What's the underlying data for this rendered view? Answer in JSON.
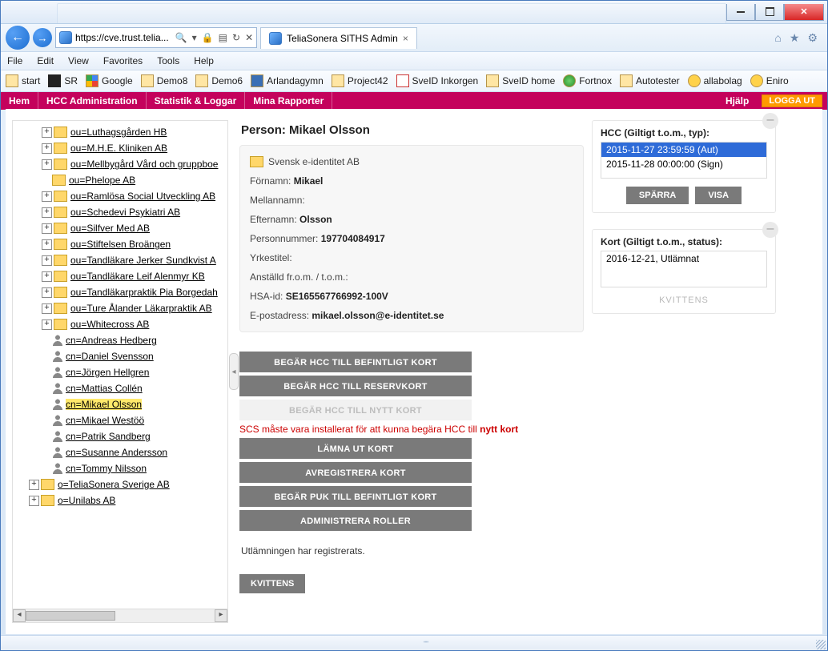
{
  "window": {
    "address_text": "https://cve.trust.telia...",
    "tab_title": "TeliaSonera SITHS Admin"
  },
  "menu": {
    "file": "File",
    "edit": "Edit",
    "view": "View",
    "favorites": "Favorites",
    "tools": "Tools",
    "help": "Help"
  },
  "favbar": [
    "start",
    "SR",
    "Google",
    "Demo8",
    "Demo6",
    "Arlandagymn",
    "Project42",
    "SveID Inkorgen",
    "SveID home",
    "Fortnox",
    "Autotester",
    "allabolag",
    "Eniro"
  ],
  "app_nav": {
    "hem": "Hem",
    "hcc": "HCC Administration",
    "stat": "Statistik & Loggar",
    "rapp": "Mina Rapporter",
    "help": "Hjälp",
    "logout": "LOGGA UT"
  },
  "tree": {
    "ou": [
      "ou=Luthagsgården HB",
      "ou=M.H.E. Kliniken AB",
      "ou=Mellbygård Vård och gruppboe",
      "ou=Phelope AB",
      "ou=Ramlösa Social Utveckling AB",
      "ou=Schedevi Psykiatri AB",
      "ou=Silfver Med AB",
      "ou=Stiftelsen Broängen",
      "ou=Tandläkare Jerker Sundkvist A",
      "ou=Tandläkare Leif Alenmyr KB",
      "ou=Tandläkarpraktik Pia Borgedah",
      "ou=Ture Ålander Läkarpraktik AB",
      "ou=Whitecross AB"
    ],
    "cn": [
      "cn=Andreas Hedberg",
      "cn=Daniel Svensson",
      "cn=Jörgen Hellgren",
      "cn=Mattias Collén",
      "cn=Mikael Olsson",
      "cn=Mikael Westöö",
      "cn=Patrik Sandberg",
      "cn=Susanne Andersson",
      "cn=Tommy Nilsson"
    ],
    "org": [
      "o=TeliaSonera Sverige AB",
      "o=Unilabs AB"
    ]
  },
  "person": {
    "title": "Person: Mikael Olsson",
    "org": "Svensk e-identitet AB",
    "fornamn_label": "Förnamn:",
    "fornamn": "Mikael",
    "mellan_label": "Mellannamn:",
    "mellan": "",
    "efter_label": "Efternamn:",
    "efter": "Olsson",
    "pnr_label": "Personnummer:",
    "pnr": "197704084917",
    "yrke_label": "Yrkestitel:",
    "yrke": "",
    "anst_label": "Anställd fr.o.m. / t.o.m.:",
    "anst": "",
    "hsa_label": "HSA-id:",
    "hsa": "SE165567766992-100V",
    "epost_label": "E-postadress:",
    "epost": "mikael.olsson@e-identitet.se"
  },
  "actions": {
    "a1": "BEGÄR HCC TILL BEFINTLIGT KORT",
    "a2": "BEGÄR HCC TILL RESERVKORT",
    "a3": "BEGÄR HCC TILL NYTT KORT",
    "warn_pre": "SCS måste vara installerat för att kunna begära HCC till ",
    "warn_bold": "nytt kort",
    "a4": "LÄMNA UT KORT",
    "a5": "AVREGISTRERA KORT",
    "a6": "BEGÄR PUK TILL BEFINTLIGT KORT",
    "a7": "ADMINISTRERA ROLLER"
  },
  "status_msg": "Utlämningen har registrerats.",
  "kvittens_btn": "KVITTENS",
  "hcc_panel": {
    "title": "HCC (Giltigt t.o.m., typ):",
    "rows": [
      {
        "text": "2015-11-27 23:59:59 (Aut)",
        "sel": true
      },
      {
        "text": "2015-11-28 00:00:00 (Sign)",
        "sel": false
      }
    ],
    "sparra": "SPÄRRA",
    "visa": "VISA"
  },
  "kort_panel": {
    "title": "Kort (Giltigt t.o.m., status):",
    "row": "2016-12-21, Utlämnat",
    "kvittens": "KVITTENS"
  }
}
